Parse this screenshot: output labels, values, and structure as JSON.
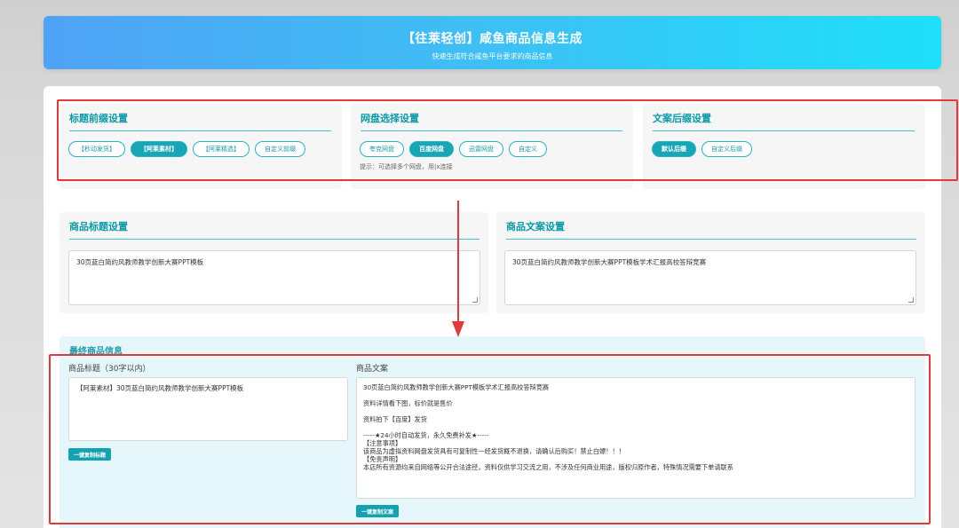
{
  "header": {
    "title": "【往莱轻创】咸鱼商品信息生成",
    "subtitle": "快速生成符合咸鱼平台要求的商品信息"
  },
  "prefix": {
    "title": "标题前缀设置",
    "options": [
      {
        "label": "【秒动发货】",
        "active": false
      },
      {
        "label": "【阿莱素材】",
        "active": true
      },
      {
        "label": "【阿莱精选】",
        "active": false
      },
      {
        "label": "自定义前缀",
        "active": false
      }
    ]
  },
  "netdisk": {
    "title": "网盘选择设置",
    "options": [
      {
        "label": "夸克网盘",
        "active": false
      },
      {
        "label": "百度网盘",
        "active": true
      },
      {
        "label": "迅雷网盘",
        "active": false
      },
      {
        "label": "自定义",
        "active": false
      }
    ],
    "hint": "提示：可选择多个网盘，用|x连接"
  },
  "suffix": {
    "title": "文案后缀设置",
    "options": [
      {
        "label": "默认后缀",
        "active": true
      },
      {
        "label": "自定义后缀",
        "active": false
      }
    ]
  },
  "product_title": {
    "title": "商品标题设置",
    "value": "30页蓝白简约风教师教学创新大赛PPT模板"
  },
  "product_desc": {
    "title": "商品文案设置",
    "value": "30页蓝白简约风教师教学创新大赛PPT模板学术汇报高校答辩竞赛"
  },
  "final": {
    "title": "最终商品信息",
    "title_label": "商品标题（30字以内）",
    "title_value": "【阿莱素材】30页蓝白简约风教师教学创新大赛PPT模板",
    "copy_title_button": "一键复制标题",
    "desc_label": "商品文案",
    "desc_lines": [
      "30页蓝白简约风教师教学创新大赛PPT模板学术汇报高校答辩竞赛",
      "",
      "资料详情看下图，标价就是售价",
      "",
      "资料拍下【百度】发货",
      "",
      "-----★24小时自动发货，永久免费补发★-----",
      "【注意事项】",
      "该商品为虚拟资料网盘发货具有可复制性一经发货概不退换，请确认后购买！禁止白嫖！！！",
      "【免责声明】",
      "本店所有资源均来自网络等公开合法途径，资料仅供学习交流之用，不涉及任何商业用途，版权归原作者，特殊情况需要下单请联系"
    ],
    "copy_desc_button": "一键复制文案"
  },
  "colors": {
    "accent": "#17a6b5",
    "annotation": "#e5383b"
  }
}
